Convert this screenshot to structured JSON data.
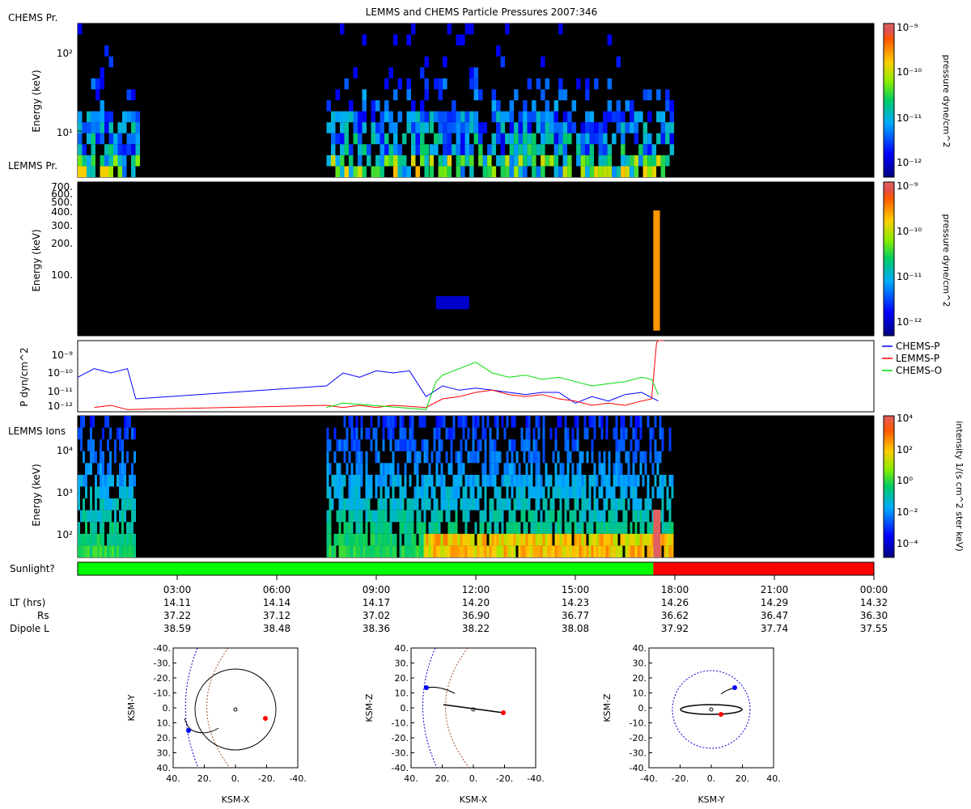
{
  "title": "LEMMS and CHEMS Particle Pressures  2007:346",
  "chart_data": [
    {
      "type": "heatmap",
      "panel": "chems",
      "panel_label": "CHEMS Pr.",
      "ylabel": "Energy (keV)",
      "yscale": "log",
      "ylim": [
        3,
        250
      ],
      "yticks": [
        "10¹",
        "10²"
      ],
      "colorbar": {
        "label": "pressure dyne/cm^2",
        "ticks": [
          "10⁻⁹",
          "10⁻¹⁰",
          "10⁻¹¹",
          "10⁻¹²"
        ],
        "range_log10": [
          -12.3,
          -9
        ]
      },
      "active_intervals_hours": [
        [
          0,
          1.75
        ],
        [
          7.5,
          10.5
        ],
        [
          10.6,
          17.9
        ]
      ]
    },
    {
      "type": "heatmap",
      "panel": "lemms_pressure",
      "panel_label": "LEMMS Pr.",
      "ylabel": "Energy (keV)",
      "yscale": "log",
      "ylim": [
        25,
        750
      ],
      "yticks": [
        "100.",
        "200.",
        "300.",
        "400.",
        "500.",
        "600.",
        "700."
      ],
      "colorbar": {
        "label": "pressure dyne/cm^2",
        "ticks": [
          "10⁻⁹",
          "10⁻¹⁰",
          "10⁻¹¹",
          "10⁻¹²"
        ],
        "range_log10": [
          -12.3,
          -9
        ]
      },
      "features": [
        {
          "t_hours": [
            10.8,
            11.8
          ],
          "energy_keV": [
            45,
            60
          ],
          "log10_pressure": -12
        },
        {
          "t_hours": [
            17.35,
            17.55
          ],
          "energy_keV": [
            28,
            400
          ],
          "log10_pressure": -9.6
        }
      ]
    },
    {
      "type": "line",
      "panel": "pressure_lines",
      "ylabel": "P dyn/cm^2",
      "yscale": "log",
      "ylim_log10": [
        -12.2,
        -8.9
      ],
      "yticks": [
        "10⁻⁹",
        "10⁻¹⁰",
        "10⁻¹¹",
        "10⁻¹²"
      ],
      "series": [
        {
          "name": "CHEMS-P",
          "color": "#0000ff",
          "x": [
            0,
            0.5,
            1.0,
            1.5,
            1.75,
            7.5,
            8.0,
            8.5,
            9.0,
            9.5,
            10.0,
            10.5,
            11.0,
            11.5,
            12.0,
            12.5,
            13.0,
            13.5,
            14.0,
            14.5,
            15.0,
            15.5,
            16.0,
            16.5,
            17.0,
            17.5
          ],
          "y": [
            -10.6,
            -10.2,
            -10.4,
            -10.2,
            -11.6,
            -11.0,
            -10.4,
            -10.6,
            -10.3,
            -10.4,
            -10.3,
            -11.5,
            -11.0,
            -11.2,
            -11.1,
            -11.2,
            -11.3,
            -11.4,
            -11.3,
            -11.3,
            -11.8,
            -11.5,
            -11.7,
            -11.4,
            -11.3,
            -11.7
          ]
        },
        {
          "name": "LEMMS-P",
          "color": "#ff0000",
          "x": [
            0.5,
            1.0,
            1.5,
            7.5,
            8.0,
            8.5,
            9.0,
            9.5,
            10.5,
            11.0,
            11.5,
            12.0,
            12.5,
            13.0,
            13.5,
            14.0,
            14.5,
            15.0,
            15.5,
            16.0,
            16.5,
            17.0,
            17.3,
            17.45,
            17.5,
            17.65
          ],
          "y": [
            -12.0,
            -11.9,
            -12.1,
            -11.9,
            -12.0,
            -11.9,
            -12.0,
            -11.9,
            -12.0,
            -11.6,
            -11.5,
            -11.3,
            -11.2,
            -11.4,
            -11.5,
            -11.4,
            -11.6,
            -11.7,
            -11.9,
            -11.8,
            -11.9,
            -11.7,
            -11.6,
            -9.0,
            -8.9,
            -8.9
          ]
        },
        {
          "name": "CHEMS-O",
          "color": "#00dd00",
          "x": [
            7.5,
            8.0,
            10.5,
            10.8,
            11.0,
            11.5,
            12.0,
            12.5,
            13.0,
            13.5,
            14.0,
            14.5,
            15.0,
            15.5,
            16.0,
            16.5,
            17.0,
            17.3,
            17.5
          ],
          "y": [
            -12.0,
            -11.8,
            -12.1,
            -10.8,
            -10.5,
            -10.2,
            -9.9,
            -10.4,
            -10.6,
            -10.5,
            -10.7,
            -10.6,
            -10.8,
            -11.0,
            -10.9,
            -10.8,
            -10.6,
            -10.7,
            -11.4
          ]
        }
      ]
    },
    {
      "type": "heatmap",
      "panel": "lemms_ions",
      "panel_label": "LEMMS Ions",
      "ylabel": "Energy (keV)",
      "yscale": "log",
      "ylim": [
        25,
        80000
      ],
      "yticks": [
        "10²",
        "10³",
        "10⁴"
      ],
      "colorbar": {
        "label": "intensity 1/(s cm^2 ster keV)",
        "ticks": [
          "10⁴",
          "10²",
          "10⁰",
          "10⁻²",
          "10⁻⁴"
        ],
        "range_log10": [
          -5,
          4
        ]
      },
      "active_intervals_hours": [
        [
          0,
          1.75
        ],
        [
          7.5,
          17.9
        ]
      ]
    }
  ],
  "sunlight": {
    "label": "Sunlight?",
    "segments": [
      {
        "from": 0,
        "to": 17.35,
        "value": "yes",
        "color": "#00ff00"
      },
      {
        "from": 17.35,
        "to": 24,
        "value": "no",
        "color": "#ff0000"
      }
    ]
  },
  "time_axis": {
    "tick_hours": [
      3,
      6,
      9,
      12,
      15,
      18,
      21,
      24
    ],
    "tick_labels": [
      "03:00",
      "06:00",
      "09:00",
      "12:00",
      "15:00",
      "18:00",
      "21:00",
      "00:00"
    ],
    "rows": [
      {
        "label": "LT (hrs)",
        "values": [
          "14.11",
          "14.14",
          "14.17",
          "14.20",
          "14.23",
          "14.26",
          "14.29",
          "14.32"
        ]
      },
      {
        "label": "Rs",
        "values": [
          "37.22",
          "37.12",
          "37.02",
          "36.90",
          "36.77",
          "36.62",
          "36.47",
          "36.30"
        ]
      },
      {
        "label": "Dipole L",
        "values": [
          "38.59",
          "38.48",
          "38.36",
          "38.22",
          "38.08",
          "37.92",
          "37.74",
          "37.55"
        ]
      }
    ]
  },
  "orbit_plots": [
    {
      "xlabel": "KSM-X",
      "ylabel": "KSM-Y",
      "xticks": [
        "40.",
        "20.",
        "0.",
        "-20.",
        "-40."
      ],
      "yticks": [
        "-40.",
        "-30.",
        "-20.",
        "-10.",
        "0.",
        "10.",
        "20.",
        "30.",
        "40."
      ]
    },
    {
      "xlabel": "KSM-X",
      "ylabel": "KSM-Z",
      "xticks": [
        "40.",
        "20.",
        "0.",
        "-20.",
        "-40."
      ],
      "yticks": [
        "40.",
        "30.",
        "20.",
        "10.",
        "0.",
        "-10.",
        "-20.",
        "-30.",
        "-40."
      ]
    },
    {
      "xlabel": "KSM-Y",
      "ylabel": "KSM-Z",
      "xticks": [
        "-40.",
        "-20.",
        "0.",
        "20.",
        "40."
      ],
      "yticks": [
        "40.",
        "30.",
        "20.",
        "10.",
        "0.",
        "-10.",
        "-20.",
        "-30.",
        "-40."
      ]
    }
  ]
}
